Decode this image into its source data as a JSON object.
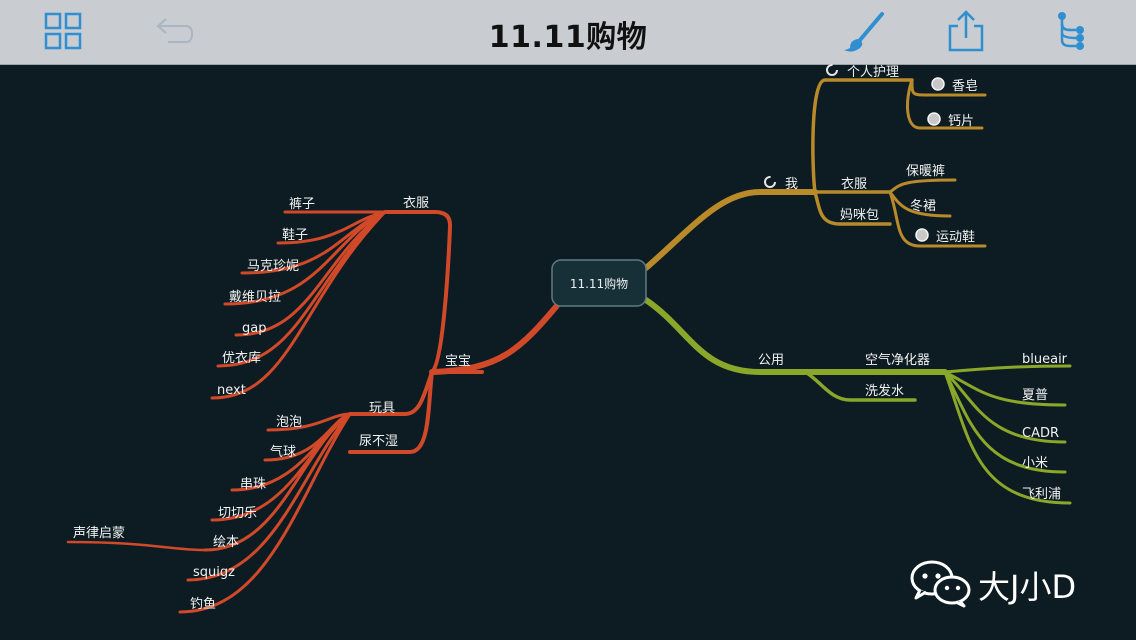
{
  "toolbar": {
    "title": "11.11购物",
    "icons": [
      "grid-icon",
      "undo-icon",
      "brush-icon",
      "share-icon",
      "tree-icon"
    ]
  },
  "mindmap": {
    "root": "11.11购物",
    "me": {
      "label": "我",
      "personal_care": "个人护理",
      "soap": "香皂",
      "calcium": "钙片",
      "clothes": "衣服",
      "diaper_bag": "妈咪包",
      "thermal_pants": "保暖裤",
      "winter_skirt": "冬裙",
      "sneakers": "运动鞋"
    },
    "public": {
      "label": "公用",
      "air_purifier": "空气净化器",
      "shampoo": "洗发水",
      "blueair": "blueair",
      "sharp": "夏普",
      "cadr": "CADR",
      "xiaomi": "小米",
      "philips": "飞利浦"
    },
    "baby": {
      "label": "宝宝",
      "clothes": "衣服",
      "toys": "玩具",
      "diapers": "尿不湿",
      "pants": "裤子",
      "shoes": "鞋子",
      "marc_janie": "马克珍妮",
      "david_bella": "戴维贝拉",
      "gap": "gap",
      "uniqlo": "优衣库",
      "next": "next",
      "bubbles": "泡泡",
      "balloon": "气球",
      "beads": "串珠",
      "cut_fun": "切切乐",
      "picture_book": "绘本",
      "rhythm": "声律启蒙",
      "squigz": "squigz",
      "fishing": "钓鱼"
    }
  },
  "watermark": {
    "text": "大J小D"
  },
  "colors": {
    "background": "#0c1c22",
    "toolbar": "#c9ccd0",
    "icon": "#2f8fd0",
    "baby_branch": "#d2492a",
    "me_branch": "#b88a2a",
    "public_branch": "#8aa72a"
  }
}
